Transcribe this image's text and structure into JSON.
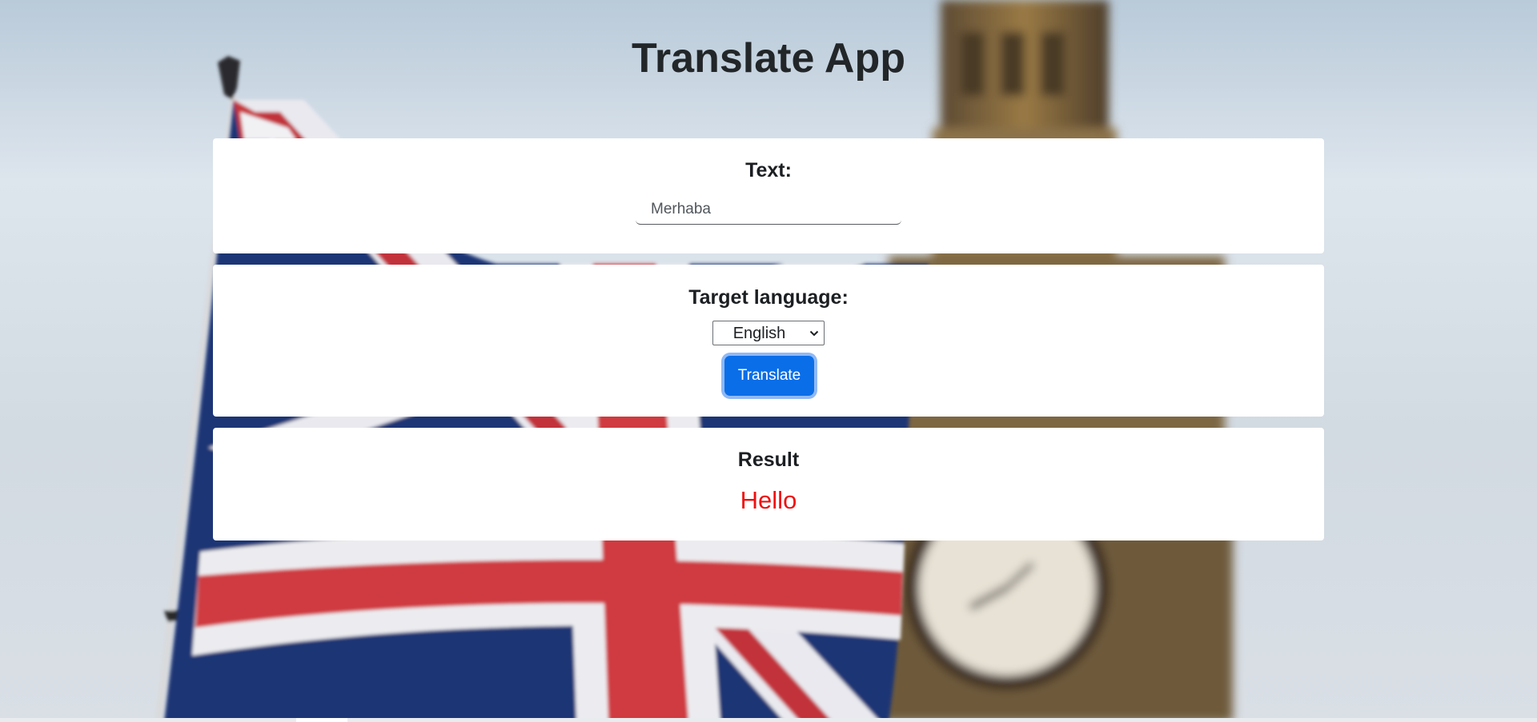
{
  "app": {
    "title": "Translate App"
  },
  "text_card": {
    "label": "Text:",
    "input_value": "Merhaba"
  },
  "language_card": {
    "label": "Target language:",
    "selected_language": "English",
    "translate_button": "Translate"
  },
  "result_card": {
    "label": "Result",
    "value": "Hello"
  },
  "colors": {
    "button": "#0a6ee8",
    "result_text": "#ef1010",
    "card_background": "#ffffff"
  },
  "icons": {
    "select_arrow": "chevron-down-icon"
  }
}
